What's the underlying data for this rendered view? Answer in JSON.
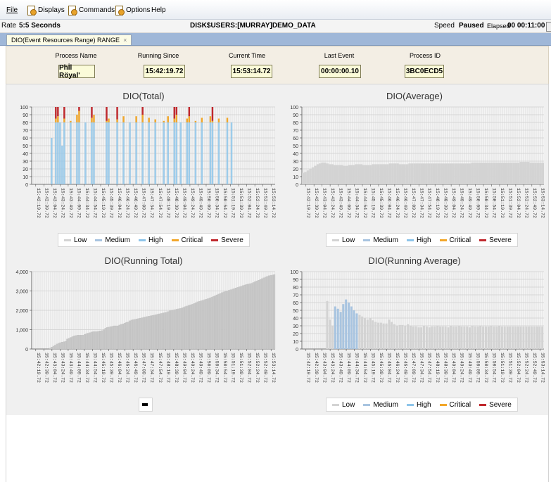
{
  "menu": {
    "file": "File",
    "displays": "Displays",
    "commands": "Commands",
    "options": "Options",
    "help": "Help"
  },
  "status": {
    "rate_label": "Rate",
    "rate_value": "5:5 Seconds",
    "path": "DISK$USERS:[MURRAY]DEMO_DATA",
    "speed_label": "Speed",
    "state": "Paused",
    "elapsed_label": "Elapsed",
    "elapsed_value": "00 00:11:00"
  },
  "tab": {
    "label": "DIO(Event Resources Range) RANGE",
    "close": "×"
  },
  "info": {
    "process_name_label": "Process Name",
    "process_name_value": "Phİl Röyal'",
    "running_since_label": "Running Since",
    "running_since_value": "15:42:19.72",
    "current_time_label": "Current Time",
    "current_time_value": "15:53:14.72",
    "last_event_label": "Last Event",
    "last_event_value": "00:00:00.10",
    "process_id_label": "Process ID",
    "process_id_value": "3BC0ECD5"
  },
  "legend": {
    "low": "Low",
    "medium": "Medium",
    "high": "High",
    "critical": "Critical",
    "severe": "Severe"
  },
  "colors": {
    "low": "#d3d3d3",
    "medium": "#a8c4e0",
    "high": "#8ec5ea",
    "critical": "#f2a72a",
    "severe": "#c0282d",
    "grid": "#cfcfcf"
  },
  "chart_data": [
    {
      "type": "bar",
      "title": "DIO(Total)",
      "ylim": [
        0,
        100
      ],
      "yticks": [
        0,
        10,
        20,
        30,
        40,
        50,
        60,
        70,
        80,
        90,
        100
      ],
      "x_tick_labels": [
        "15:42:19.72",
        "15:42:39.72",
        "15:43:04.72",
        "15:43:24.72",
        "15:43:49.72",
        "15:44:09.72",
        "15:44:34.72",
        "15:44:54.72",
        "15:45:19.72",
        "15:45:39.72",
        "15:46:04.72",
        "15:46:24.72",
        "15:46:49.72",
        "15:47:09.72",
        "15:47:34.72",
        "15:47:54.72",
        "15:48:19.72",
        "15:48:39.72",
        "15:49:04.72",
        "15:49:24.72",
        "15:49:49.72",
        "15:50:09.72",
        "15:50:34.72",
        "15:50:54.72",
        "15:51:19.72",
        "15:51:39.72",
        "15:52:04.72",
        "15:52:24.72",
        "15:52:49.72",
        "15:53:14.72"
      ],
      "peaks": [
        [
          9,
          60
        ],
        [
          11,
          85,
          100
        ],
        [
          12,
          88,
          100
        ],
        [
          13,
          80
        ],
        [
          14,
          50
        ],
        [
          15,
          85,
          100
        ],
        [
          18,
          82
        ],
        [
          21,
          90
        ],
        [
          22,
          95,
          100
        ],
        [
          25,
          80
        ],
        [
          28,
          86,
          100
        ],
        [
          29,
          90
        ],
        [
          35,
          82,
          100
        ],
        [
          36,
          85
        ],
        [
          40,
          84,
          100
        ],
        [
          43,
          88
        ],
        [
          46,
          80
        ],
        [
          49,
          88
        ],
        [
          52,
          90,
          100
        ],
        [
          55,
          86
        ],
        [
          58,
          84
        ],
        [
          62,
          82
        ],
        [
          64,
          88
        ],
        [
          67,
          85,
          100
        ],
        [
          68,
          90,
          100
        ],
        [
          70,
          80
        ],
        [
          73,
          85
        ],
        [
          74,
          88,
          100
        ],
        [
          77,
          82
        ],
        [
          80,
          86
        ],
        [
          84,
          88
        ],
        [
          85,
          82,
          100
        ],
        [
          88,
          85
        ],
        [
          92,
          86
        ],
        [
          94,
          80
        ]
      ],
      "legend": [
        "low",
        "medium",
        "high",
        "critical",
        "severe"
      ]
    },
    {
      "type": "bar",
      "title": "DIO(Average)",
      "ylim": [
        0,
        100
      ],
      "yticks": [
        0,
        10,
        20,
        30,
        40,
        50,
        60,
        70,
        80,
        90,
        100
      ],
      "values": [
        15,
        16,
        18,
        20,
        22,
        24,
        26,
        27,
        28,
        28,
        27,
        26,
        26,
        25,
        25,
        25,
        25,
        24,
        24,
        25,
        25,
        25,
        26,
        26,
        26,
        25,
        25,
        25,
        25,
        26,
        26,
        26,
        26,
        26,
        26,
        26,
        27,
        27,
        27,
        27,
        26,
        26,
        26,
        26,
        27,
        27,
        27,
        27,
        27,
        27,
        27,
        27,
        27,
        27,
        27,
        27,
        27,
        27,
        27,
        27,
        27,
        27,
        27,
        27,
        27,
        27,
        27,
        27,
        27,
        27,
        28,
        28,
        28,
        28,
        28,
        28,
        28,
        28,
        28,
        28,
        28,
        28,
        28,
        28,
        28,
        28,
        28,
        28,
        28,
        28,
        29,
        29,
        29,
        29,
        28,
        28,
        28,
        28,
        28,
        28
      ],
      "legend": [
        "low",
        "medium",
        "high",
        "critical",
        "severe"
      ]
    },
    {
      "type": "bar",
      "title": "DIO(Running Total)",
      "ylim": [
        0,
        4000
      ],
      "yticks": [
        0,
        1000,
        2000,
        3000,
        4000
      ],
      "ytick_labels": [
        "0",
        "1,000",
        "2,000",
        "3,000",
        "4,000"
      ],
      "values": [
        0,
        0,
        0,
        0,
        0,
        0,
        0,
        0,
        0,
        0,
        50,
        100,
        150,
        200,
        260,
        300,
        330,
        360,
        380,
        400,
        520,
        560,
        600,
        640,
        680,
        700,
        720,
        720,
        720,
        720,
        760,
        800,
        820,
        850,
        880,
        900,
        900,
        900,
        920,
        940,
        960,
        1000,
        1080,
        1120,
        1140,
        1160,
        1180,
        1200,
        1200,
        1200,
        1240,
        1280,
        1300,
        1340,
        1380,
        1400,
        1460,
        1500,
        1520,
        1540,
        1560,
        1580,
        1600,
        1620,
        1640,
        1660,
        1680,
        1700,
        1720,
        1740,
        1760,
        1780,
        1800,
        1820,
        1840,
        1860,
        1880,
        1900,
        1940,
        1980,
        2000,
        2020,
        2040,
        2060,
        2080,
        2100,
        2130,
        2160,
        2200,
        2230,
        2260,
        2290,
        2320,
        2360,
        2400,
        2440,
        2470,
        2500,
        2520,
        2550,
        2580,
        2610,
        2640,
        2680,
        2720,
        2760,
        2800,
        2840,
        2880,
        2920,
        2950,
        2980,
        3010,
        3040,
        3070,
        3100,
        3130,
        3160,
        3190,
        3220,
        3250,
        3280,
        3310,
        3340,
        3360,
        3380,
        3400,
        3440,
        3480,
        3520,
        3560,
        3600,
        3640,
        3680,
        3720,
        3760,
        3790,
        3810,
        3830,
        3850
      ],
      "legend_swatch": "#000000"
    },
    {
      "type": "bar",
      "title": "DIO(Running Average)",
      "ylim": [
        0,
        100
      ],
      "yticks": [
        0,
        10,
        20,
        30,
        40,
        50,
        60,
        70,
        80,
        90,
        100
      ],
      "values": [
        0,
        0,
        0,
        0,
        0,
        0,
        0,
        0,
        0,
        62,
        38,
        30,
        55,
        52,
        48,
        58,
        64,
        60,
        55,
        50,
        46,
        44,
        42,
        40,
        38,
        40,
        37,
        35,
        34,
        34,
        33,
        33,
        38,
        35,
        32,
        30,
        31,
        31,
        30,
        32,
        30,
        29,
        29,
        28,
        28,
        30,
        29,
        28,
        29,
        29,
        30,
        29,
        29,
        29,
        28,
        30,
        29,
        29,
        30,
        29,
        29,
        29,
        28,
        30,
        29,
        29,
        30,
        29,
        29,
        29,
        30,
        29,
        29,
        30,
        29,
        29,
        29,
        29,
        29,
        29,
        29,
        29,
        29,
        29,
        29,
        29,
        29,
        29,
        29,
        29
      ],
      "legend": [
        "low",
        "medium",
        "high",
        "critical",
        "severe"
      ]
    }
  ]
}
